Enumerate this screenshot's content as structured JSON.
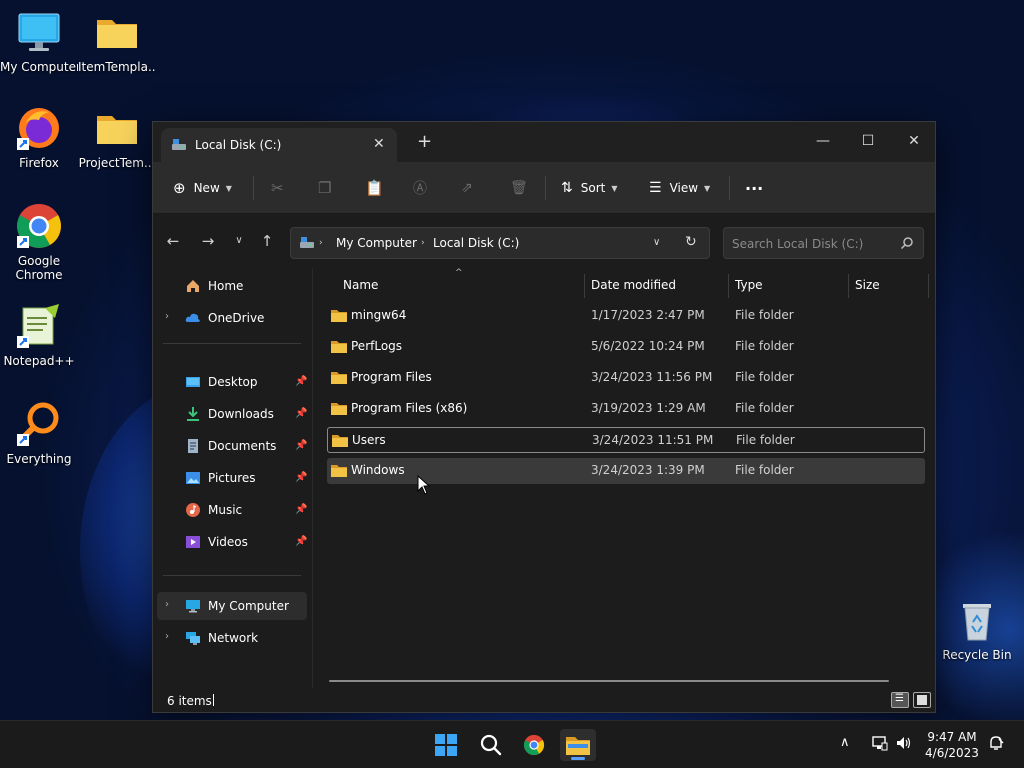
{
  "desktop": {
    "icons": [
      {
        "label": "My Computer"
      },
      {
        "label": "ItemTempla..."
      },
      {
        "label": "Firefox"
      },
      {
        "label": "ProjectTem..."
      },
      {
        "label": "Google Chrome"
      },
      {
        "label": "Notepad++"
      },
      {
        "label": "Everything"
      },
      {
        "label": "Recycle Bin"
      }
    ]
  },
  "window": {
    "tab_title": "Local Disk (C:)",
    "toolbar": {
      "new_label": "New",
      "sort_label": "Sort",
      "view_label": "View",
      "more_label": "···"
    },
    "address": {
      "crumbs": [
        "My Computer",
        "Local Disk (C:)"
      ]
    },
    "search": {
      "placeholder": "Search Local Disk (C:)"
    },
    "nav": {
      "home": "Home",
      "onedrive": "OneDrive",
      "quick": [
        {
          "label": "Desktop"
        },
        {
          "label": "Downloads"
        },
        {
          "label": "Documents"
        },
        {
          "label": "Pictures"
        },
        {
          "label": "Music"
        },
        {
          "label": "Videos"
        }
      ],
      "mycomputer": "My Computer",
      "network": "Network"
    },
    "columns": {
      "name": "Name",
      "date": "Date modified",
      "type": "Type",
      "size": "Size"
    },
    "files": [
      {
        "name": "mingw64",
        "date": "1/17/2023 2:47 PM",
        "type": "File folder"
      },
      {
        "name": "PerfLogs",
        "date": "5/6/2022 10:24 PM",
        "type": "File folder"
      },
      {
        "name": "Program Files",
        "date": "3/24/2023 11:56 PM",
        "type": "File folder"
      },
      {
        "name": "Program Files (x86)",
        "date": "3/19/2023 1:29 AM",
        "type": "File folder"
      },
      {
        "name": "Users",
        "date": "3/24/2023 11:51 PM",
        "type": "File folder"
      },
      {
        "name": "Windows",
        "date": "3/24/2023 1:39 PM",
        "type": "File folder"
      }
    ],
    "status": {
      "items": "6 items"
    }
  },
  "taskbar": {
    "time": "9:47 AM",
    "date": "4/6/2023"
  },
  "colors": {
    "folder": "#f2c244",
    "accent": "#5aa0ff",
    "window_bg": "#1c1c1c",
    "toolbar_bg": "#2c2c2c"
  }
}
